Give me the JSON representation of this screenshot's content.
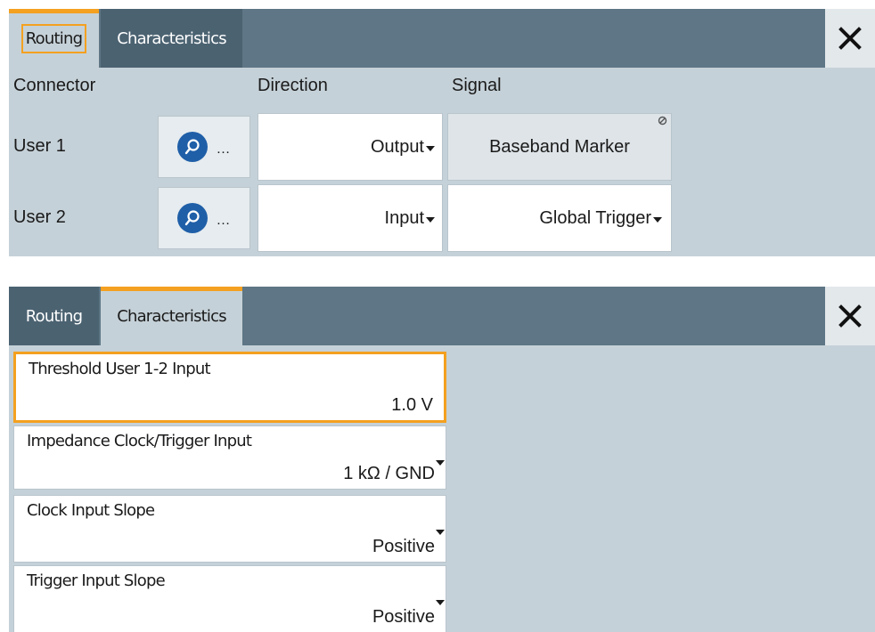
{
  "colors": {
    "panel_bg": "#c5d1d8",
    "tabbar_bg": "#5e7685",
    "accent_orange": "#f4a020",
    "search_blue": "#1f5fa8"
  },
  "panel_routing": {
    "tabs": [
      {
        "label": "Routing",
        "active": true
      },
      {
        "label": "Characteristics",
        "active": false
      }
    ],
    "close_icon": "close-icon",
    "headers": {
      "connector": "Connector",
      "direction": "Direction",
      "signal": "Signal"
    },
    "rows": [
      {
        "connector": "User 1",
        "find_icon": "search-icon",
        "find_dots": "…",
        "direction": "Output",
        "signal": "Baseband Marker",
        "signal_editable": false
      },
      {
        "connector": "User 2",
        "find_icon": "search-icon",
        "find_dots": "…",
        "direction": "Input",
        "signal": "Global Trigger",
        "signal_editable": true
      }
    ]
  },
  "panel_characteristics": {
    "tabs": [
      {
        "label": "Routing",
        "active": false
      },
      {
        "label": "Characteristics",
        "active": true
      }
    ],
    "close_icon": "close-icon",
    "fields": [
      {
        "label": "Threshold User 1-2 Input",
        "value": "1.0 V",
        "dropdown": false,
        "focused": true
      },
      {
        "label": "Impedance Clock/Trigger Input",
        "value": "1 kΩ / GND",
        "dropdown": true
      },
      {
        "label": "Clock Input Slope",
        "value": "Positive",
        "dropdown": true
      },
      {
        "label": "Trigger Input Slope",
        "value": "Positive",
        "dropdown": true
      }
    ]
  }
}
